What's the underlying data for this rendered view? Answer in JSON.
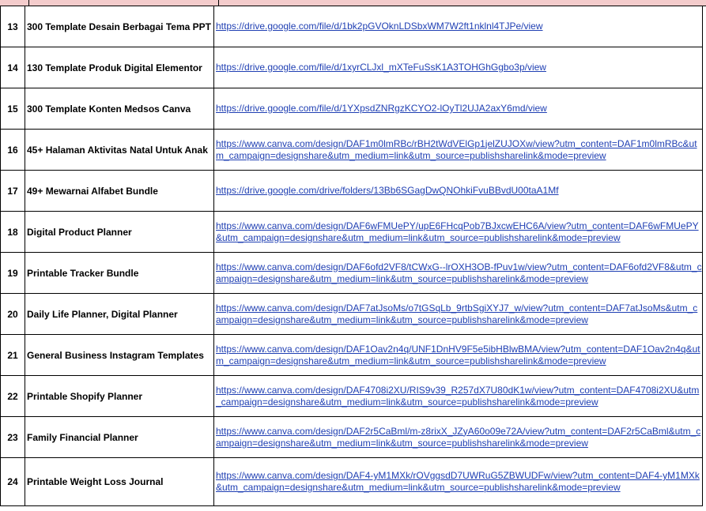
{
  "rows": [
    {
      "no": "13",
      "name": "300 Template Desain Berbagai Tema PPT",
      "link": "https://drive.google.com/file/d/1bk2pGVOknLDSbxWM7W2ft1nklnl4TJPe/view"
    },
    {
      "no": "14",
      "name": "130 Template Produk Digital Elementor",
      "link": "https://drive.google.com/file/d/1xyrCLJxl_mXTeFuSsK1A3TOHGhGgbo3p/view"
    },
    {
      "no": "15",
      "name": "300 Template Konten Medsos Canva",
      "link": "https://drive.google.com/file/d/1YXpsdZNRgzKCYO2-lOyTl2UJA2axY6md/view"
    },
    {
      "no": "16",
      "name": "45+ Halaman Aktivitas Natal Untuk Anak",
      "link": "https://www.canva.com/design/DAF1m0lmRBc/rBH2tWdVElGp1jelZUJOXw/view?utm_content=DAF1m0lmRBc&utm_campaign=designshare&utm_medium=link&utm_source=publishsharelink&mode=preview"
    },
    {
      "no": "17",
      "name": "49+ Mewarnai Alfabet Bundle",
      "link": "https://drive.google.com/drive/folders/13Bb6SGagDwQNOhkiFvuBBvdU00taA1Mf"
    },
    {
      "no": "18",
      "name": "Digital Product Planner",
      "link": "https://www.canva.com/design/DAF6wFMUePY/upE6FHcqPob7BJxcwEHC6A/view?utm_content=DAF6wFMUePY&utm_campaign=designshare&utm_medium=link&utm_source=publishsharelink&mode=preview"
    },
    {
      "no": "19",
      "name": "Printable Tracker Bundle",
      "link": "https://www.canva.com/design/DAF6ofd2VF8/tCWxG--lrOXH3OB-fPuv1w/view?utm_content=DAF6ofd2VF8&utm_campaign=designshare&utm_medium=link&utm_source=publishsharelink&mode=preview"
    },
    {
      "no": "20",
      "name": "Daily Life Planner, Digital Planner",
      "link": "https://www.canva.com/design/DAF7atJsoMs/o7tGSqLb_9rtbSgiXYJ7_w/view?utm_content=DAF7atJsoMs&utm_campaign=designshare&utm_medium=link&utm_source=publishsharelink&mode=preview"
    },
    {
      "no": "21",
      "name": "General Business Instagram Templates",
      "link": "https://www.canva.com/design/DAF1Oav2n4q/UNF1DnHV9F5e5ibHBlwBMA/view?utm_content=DAF1Oav2n4q&utm_campaign=designshare&utm_medium=link&utm_source=publishsharelink&mode=preview"
    },
    {
      "no": "22",
      "name": "Printable Shopify Planner",
      "link": "https://www.canva.com/design/DAF4708i2XU/RIS9v39_R257dX7U80dK1w/view?utm_content=DAF4708i2XU&utm_campaign=designshare&utm_medium=link&utm_source=publishsharelink&mode=preview"
    },
    {
      "no": "23",
      "name": "Family Financial Planner",
      "link": "https://www.canva.com/design/DAF2r5CaBml/m-z8rixX_JZyA60o09e72A/view?utm_content=DAF2r5CaBml&utm_campaign=designshare&utm_medium=link&utm_source=publishsharelink&mode=preview"
    },
    {
      "no": "24",
      "name": "Printable Weight Loss Journal",
      "link": "https://www.canva.com/design/DAF4-yM1MXk/rOVggsdD7UWRuG5ZBWUDFw/view?utm_content=DAF4-yM1MXk&utm_campaign=designshare&utm_medium=link&utm_source=publishsharelink&mode=preview"
    }
  ]
}
